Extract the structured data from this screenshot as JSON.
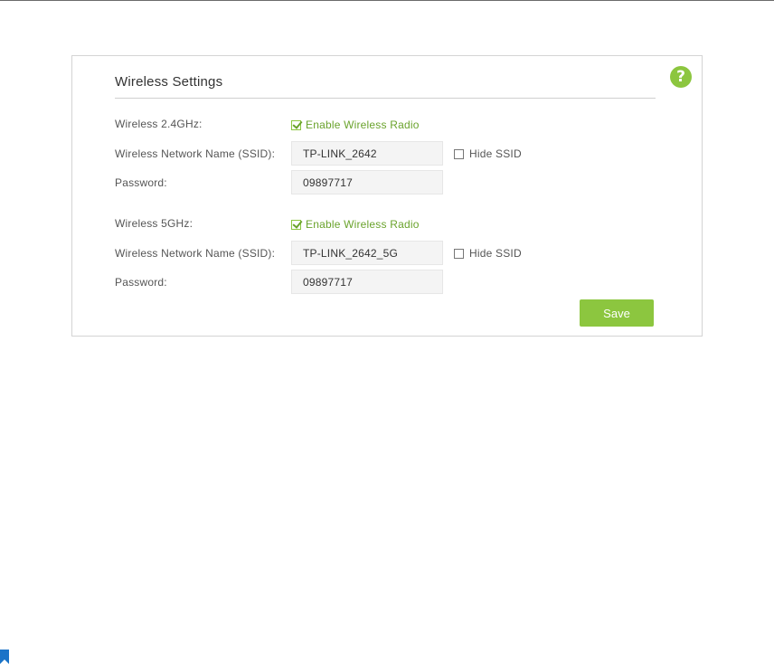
{
  "section": {
    "title": "Wireless Settings",
    "help_icon": "?"
  },
  "band_24": {
    "label": "Wireless 2.4GHz:",
    "enable_label": "Enable Wireless Radio",
    "enabled": true,
    "ssid_label": "Wireless Network Name (SSID):",
    "ssid_value": "TP-LINK_2642",
    "hide_ssid_label": "Hide SSID",
    "hide_ssid": false,
    "password_label": "Password:",
    "password_value": "09897717"
  },
  "band_5": {
    "label": "Wireless 5GHz:",
    "enable_label": "Enable Wireless Radio",
    "enabled": true,
    "ssid_label": "Wireless Network Name (SSID):",
    "ssid_value": "TP-LINK_2642_5G",
    "hide_ssid_label": "Hide SSID",
    "hide_ssid": false,
    "password_label": "Password:",
    "password_value": "09897717"
  },
  "actions": {
    "save_label": "Save"
  },
  "colors": {
    "accent": "#8cc63f",
    "accent_text": "#6aa32c",
    "input_bg": "#f4f4f4",
    "corner_icon": "#1a73c8"
  },
  "icons": {
    "help": "help-icon",
    "check": "check-icon",
    "corner": "bookmark-icon"
  }
}
